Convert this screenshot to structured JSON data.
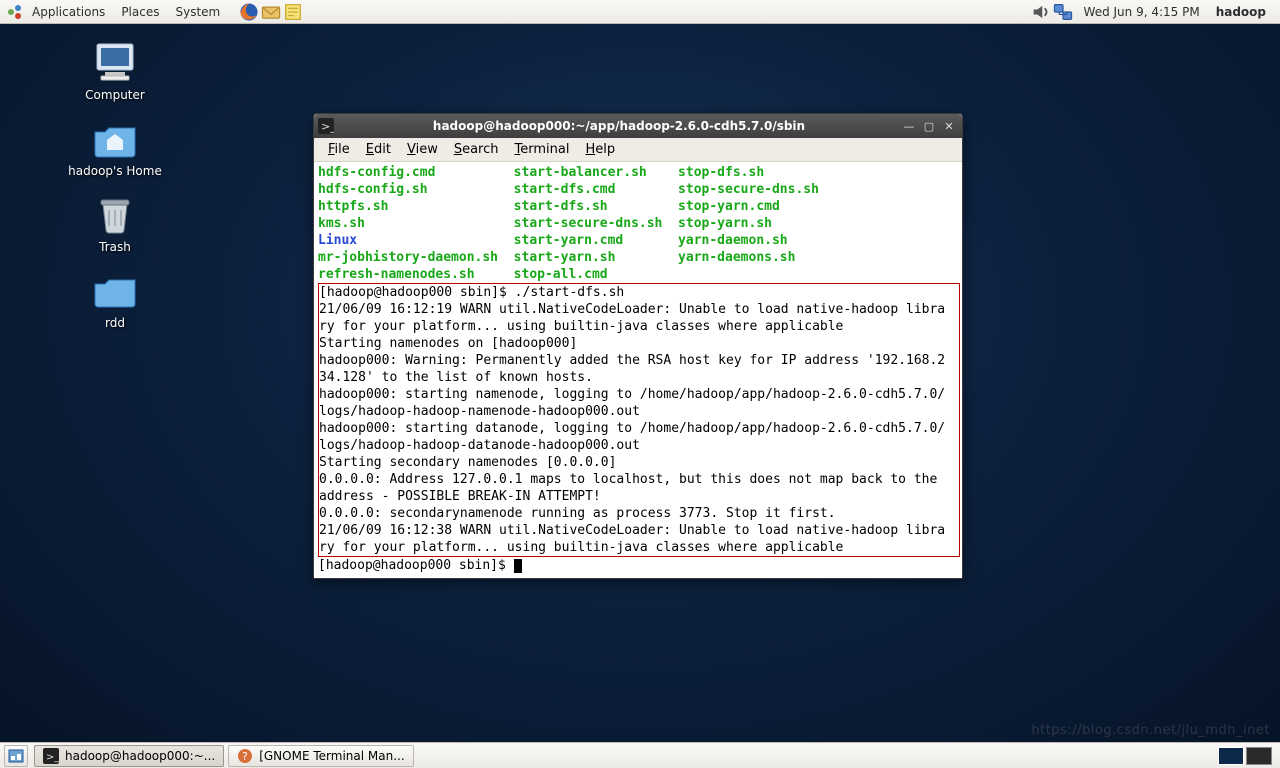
{
  "panel": {
    "menus": [
      "Applications",
      "Places",
      "System"
    ],
    "clock": "Wed Jun  9,  4:15 PM",
    "user": "hadoop"
  },
  "desktop_icons": [
    {
      "id": "computer",
      "label": "Computer"
    },
    {
      "id": "home",
      "label": "hadoop's Home"
    },
    {
      "id": "trash",
      "label": "Trash"
    },
    {
      "id": "rdd",
      "label": "rdd"
    }
  ],
  "taskbar": {
    "items": [
      {
        "label": "hadoop@hadoop000:~...",
        "active": true,
        "icon": "terminal"
      },
      {
        "label": "[GNOME Terminal Man...",
        "active": false,
        "icon": "help"
      }
    ]
  },
  "terminal": {
    "title": "hadoop@hadoop000:~/app/hadoop-2.6.0-cdh5.7.0/sbin",
    "menus": [
      "File",
      "Edit",
      "View",
      "Search",
      "Terminal",
      "Help"
    ],
    "prompt1": "[hadoop@hadoop000 sbin]$ ",
    "cmd1": "./start-dfs.sh",
    "prompt2": "[hadoop@hadoop000 sbin]$ ",
    "listing": [
      {
        "c1": "hdfs-config.cmd",
        "c2": "start-balancer.sh",
        "c3": "stop-dfs.sh"
      },
      {
        "c1": "hdfs-config.sh",
        "c2": "start-dfs.cmd",
        "c3": "stop-secure-dns.sh"
      },
      {
        "c1": "httpfs.sh",
        "c2": "start-dfs.sh",
        "c3": "stop-yarn.cmd"
      },
      {
        "c1": "kms.sh",
        "c2": "start-secure-dns.sh",
        "c3": "stop-yarn.sh"
      },
      {
        "c1": "Linux",
        "c2": "start-yarn.cmd",
        "c3": "yarn-daemon.sh",
        "c1_bold": true
      },
      {
        "c1": "mr-jobhistory-daemon.sh",
        "c2": "start-yarn.sh",
        "c3": "yarn-daemons.sh"
      },
      {
        "c1": "refresh-namenodes.sh",
        "c2": "stop-all.cmd",
        "c3": ""
      }
    ],
    "output": [
      "21/06/09 16:12:19 WARN util.NativeCodeLoader: Unable to load native-hadoop libra",
      "ry for your platform... using builtin-java classes where applicable",
      "Starting namenodes on [hadoop000]",
      "hadoop000: Warning: Permanently added the RSA host key for IP address '192.168.2",
      "34.128' to the list of known hosts.",
      "hadoop000: starting namenode, logging to /home/hadoop/app/hadoop-2.6.0-cdh5.7.0/",
      "logs/hadoop-hadoop-namenode-hadoop000.out",
      "hadoop000: starting datanode, logging to /home/hadoop/app/hadoop-2.6.0-cdh5.7.0/",
      "logs/hadoop-hadoop-datanode-hadoop000.out",
      "Starting secondary namenodes [0.0.0.0]",
      "0.0.0.0: Address 127.0.0.1 maps to localhost, but this does not map back to the ",
      "address - POSSIBLE BREAK-IN ATTEMPT!",
      "0.0.0.0: secondarynamenode running as process 3773. Stop it first.",
      "21/06/09 16:12:38 WARN util.NativeCodeLoader: Unable to load native-hadoop libra",
      "ry for your platform... using builtin-java classes where applicable"
    ]
  },
  "watermark": "https://blog.csdn.net/jlu_mdh_inet"
}
